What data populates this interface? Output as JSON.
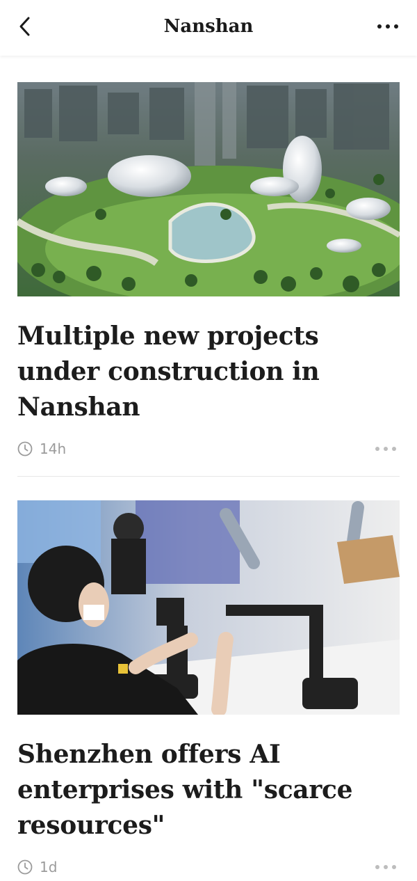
{
  "header": {
    "title": "Nanshan"
  },
  "articles": [
    {
      "headline": "Multiple new projects under construction in Nanshan",
      "time": "14h"
    },
    {
      "headline": "Shenzhen offers AI enterprises with \"scarce resources\"",
      "time": "1d"
    }
  ],
  "icons": {
    "back": "chevron-left-icon",
    "more": "more-horizontal-icon",
    "clock": "clock-icon"
  },
  "colors": {
    "text": "#1c1c1c",
    "meta": "#9b9b9b",
    "divider": "#e6e6e6"
  }
}
